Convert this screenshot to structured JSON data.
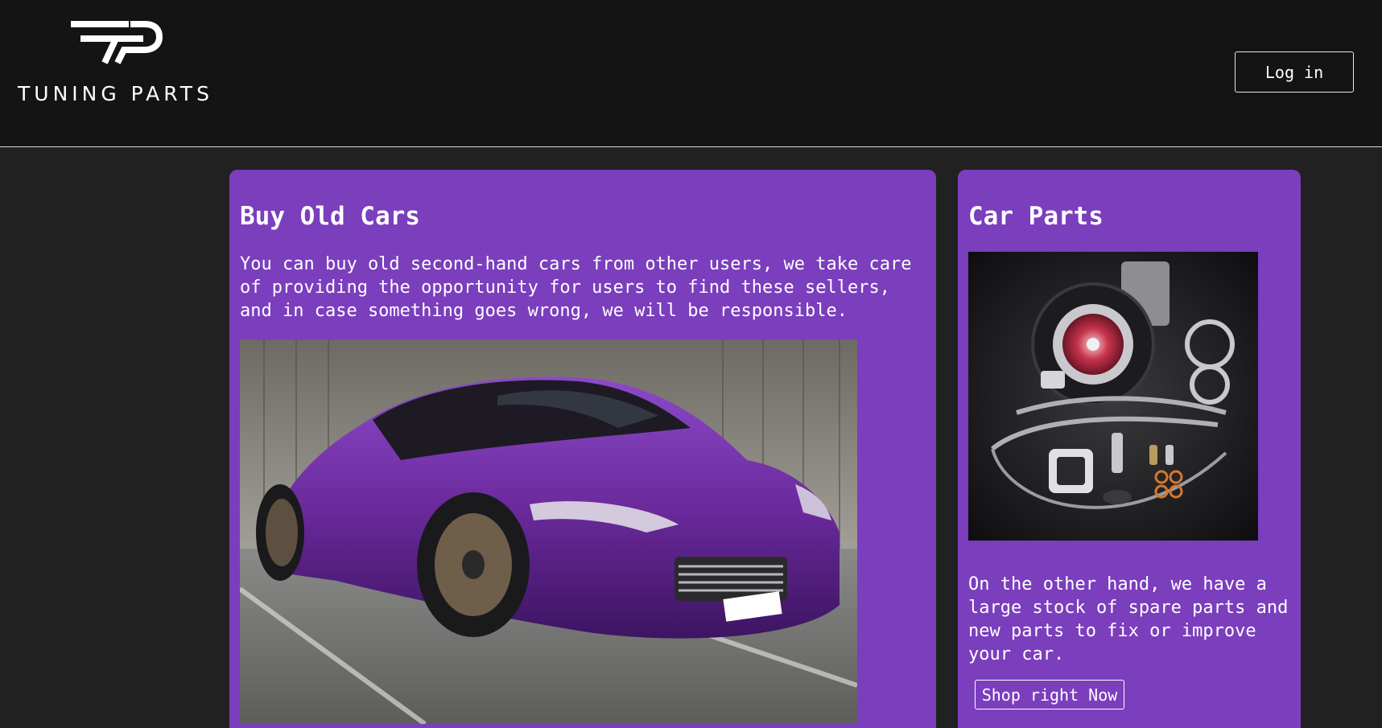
{
  "header": {
    "logo_text": "TUNING PARTS",
    "login_label": "Log in"
  },
  "cards": {
    "used_cars": {
      "title": "Buy Old Cars",
      "description": "You can buy old second-hand cars from other users, we take care of providing the opportunity for users to find these sellers, and in case something goes wrong, we will be responsible."
    },
    "car_parts": {
      "title": "Car Parts",
      "description": "On the other hand, we have a large stock of spare parts and new parts to fix or improve your car.",
      "button_label": "Shop right Now"
    }
  },
  "colors": {
    "header_bg": "#141414",
    "page_bg": "#212121",
    "card_purple": "#7b3ebd",
    "car_purple": "#6a2a9c"
  },
  "icons": {
    "logo": "tp-logo-icon"
  }
}
